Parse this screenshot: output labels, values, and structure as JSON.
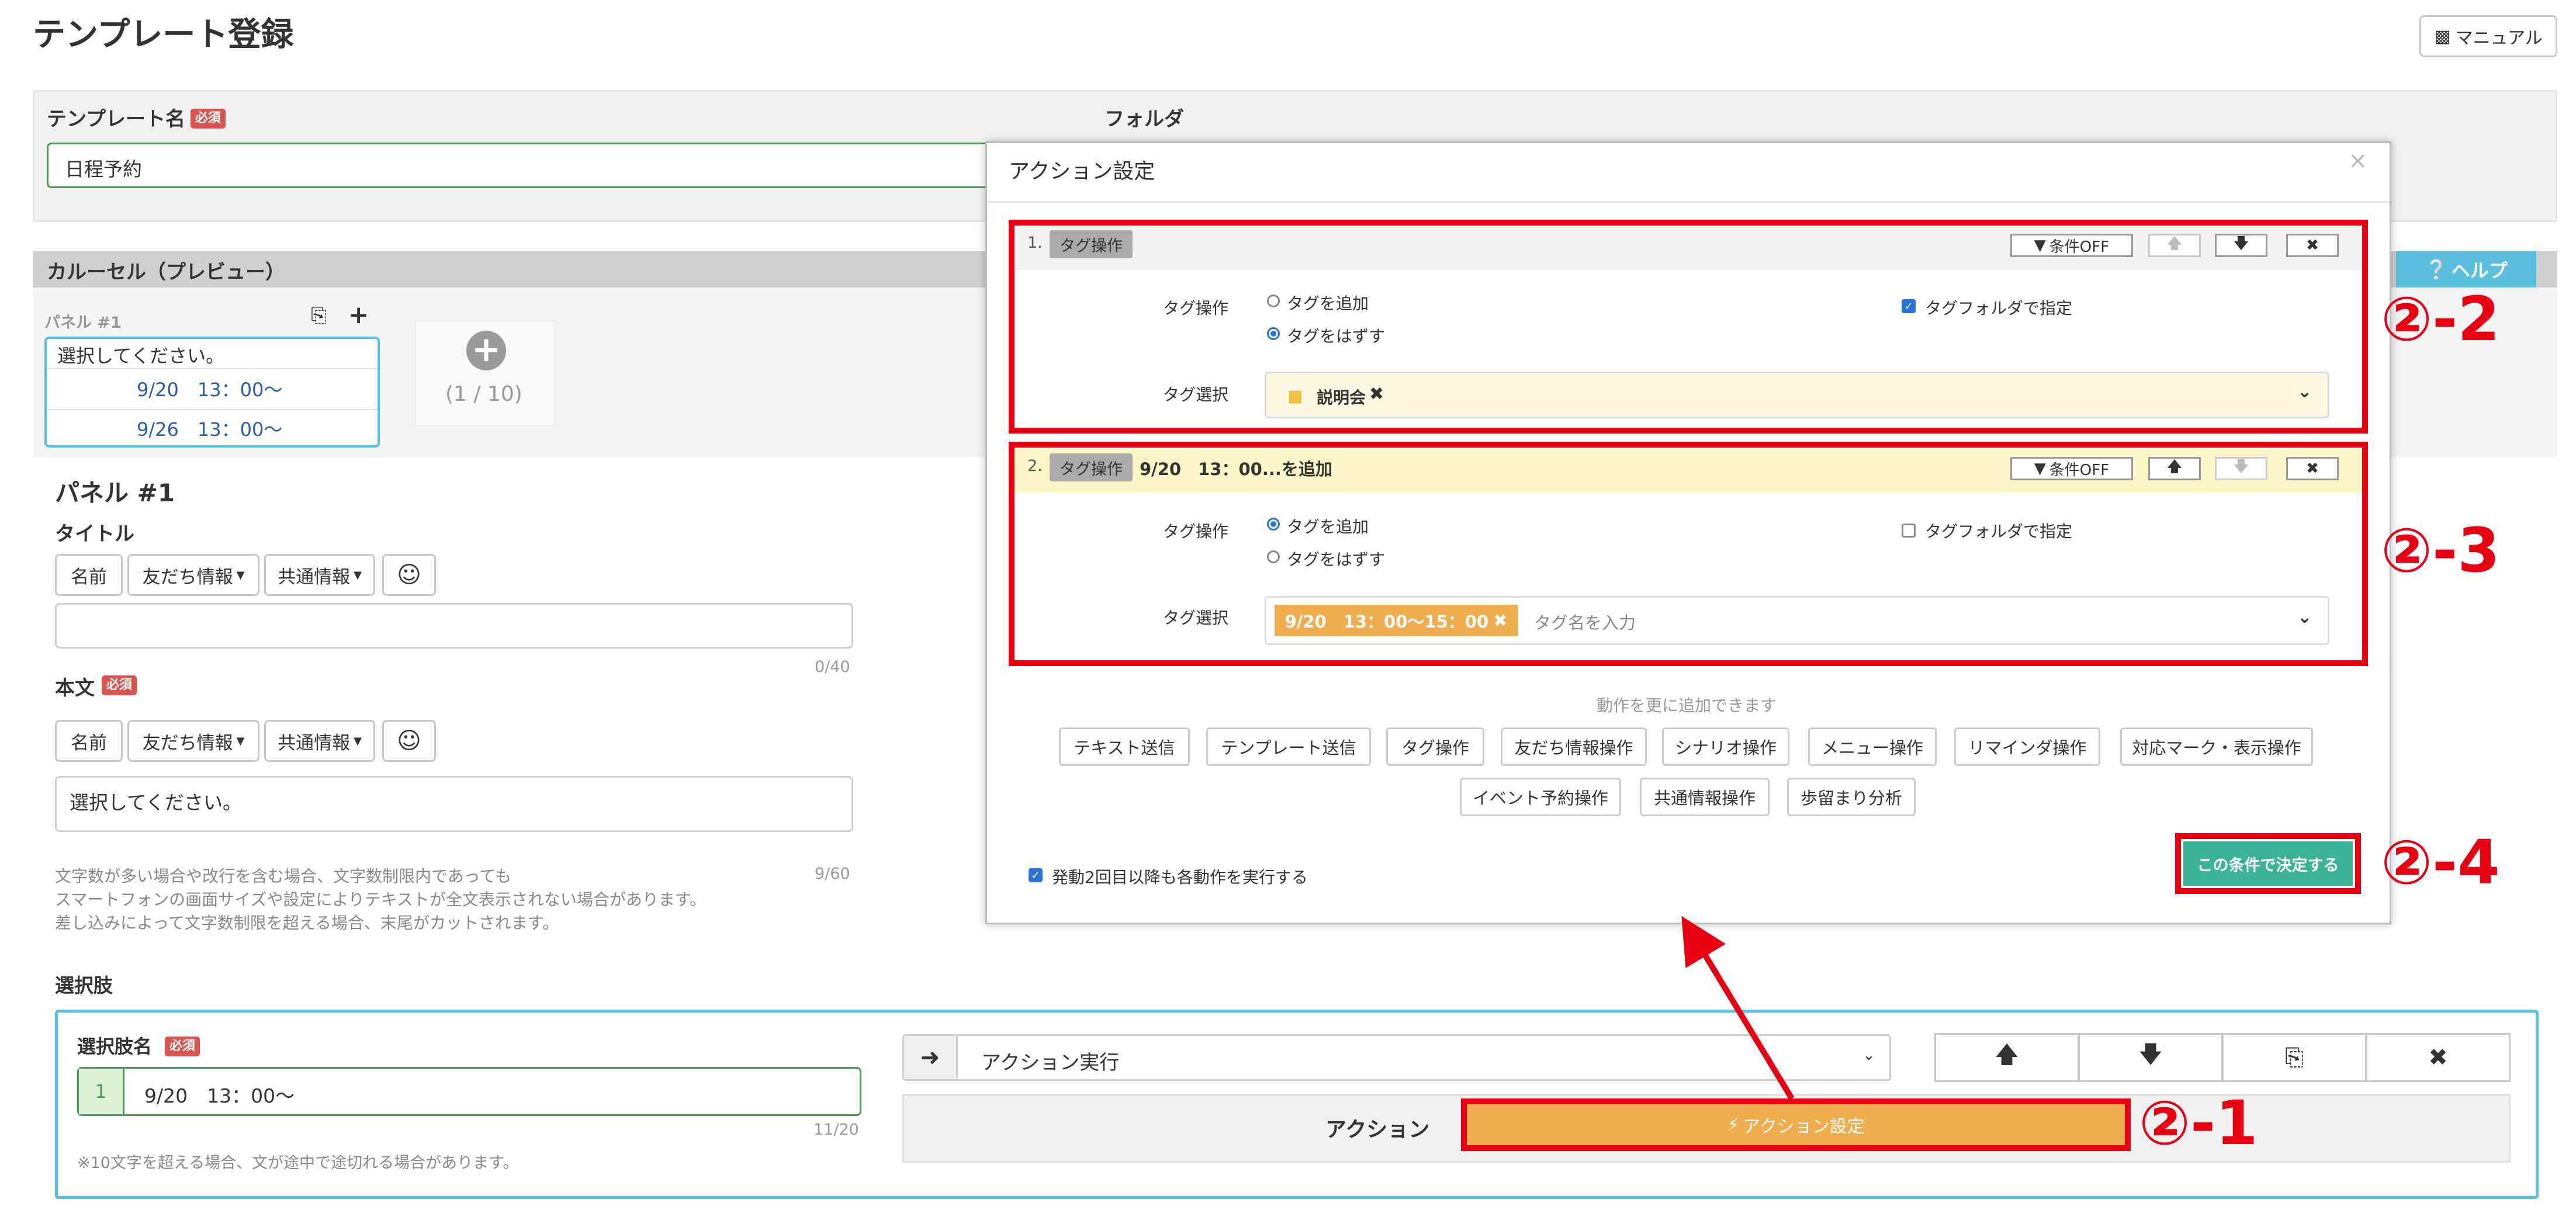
{
  "page": {
    "title": "テンプレート登録",
    "manual_button": "マニュアル"
  },
  "form": {
    "template_name_label": "テンプレート名",
    "required_badge": "必須",
    "template_name_value": "日程予約",
    "folder_label": "フォルダ"
  },
  "carousel": {
    "header": "カルーセル（プレビュー）",
    "help_label": "ヘルプ",
    "panel_tab_label": "パネル #1",
    "preview_text": "選択してください。",
    "preview_options": [
      "9/20　13：00〜",
      "9/26　13：00〜"
    ],
    "counter": "(1 / 10)"
  },
  "panel": {
    "heading": "パネル #1",
    "title_label": "タイトル",
    "insert_buttons": [
      "名前",
      "友だち情報",
      "共通情報"
    ],
    "title_count": "0/40",
    "body_label": "本文",
    "body_value": "選択してください。",
    "body_count": "9/60",
    "notes": [
      "文字数が多い場合や改行を含む場合、文字数制限内であっても",
      "スマートフォンの画面サイズや設定によりテキストが全文表示されない場合があります。",
      "差し込みによって文字数制限を超える場合、末尾がカットされます。"
    ]
  },
  "choices": {
    "section_label": "選択肢",
    "name_label": "選択肢名",
    "index": "1",
    "name_value": "9/20　13：00〜",
    "name_count": "11/20",
    "name_note": "※10文字を超える場合、文が途中で途切れる場合があります。",
    "action_select_value": "アクション実行",
    "action_label": "アクション",
    "action_button": "アクション設定"
  },
  "modal": {
    "title": "アクション設定",
    "condition_off": "条件OFF",
    "item1": {
      "number": "1.",
      "type_badge": "タグ操作",
      "summary": "",
      "op_label": "タグ操作",
      "option_add": "タグを追加",
      "option_remove": "タグをはずす",
      "folder_check": "タグフォルダで指定",
      "select_label": "タグ選択",
      "selected_tag": "説明会"
    },
    "item2": {
      "number": "2.",
      "type_badge": "タグ操作",
      "summary": "9/20　13：00...を追加",
      "op_label": "タグ操作",
      "option_add": "タグを追加",
      "option_remove": "タグをはずす",
      "folder_check": "タグフォルダで指定",
      "select_label": "タグ選択",
      "selected_tag": "9/20　13：00〜15：00",
      "tag_placeholder": "タグ名を入力"
    },
    "more_actions_hint": "動作を更に追加できます",
    "action_buttons_row1": [
      "テキスト送信",
      "テンプレート送信",
      "タグ操作",
      "友だち情報操作",
      "シナリオ操作",
      "メニュー操作",
      "リマインダ操作",
      "対応マーク・表示操作"
    ],
    "action_buttons_row2": [
      "イベント予約操作",
      "共通情報操作",
      "歩留まり分析"
    ],
    "repeat_check": "発動2回目以降も各動作を実行する",
    "confirm_button": "この条件で決定する"
  },
  "callouts": {
    "c1": "②-1",
    "c2": "②-2",
    "c3": "②-3",
    "c4": "②-4"
  },
  "colors": {
    "accent_red": "#e60012",
    "confirm_green": "#3bb397",
    "action_orange": "#f0ad4e",
    "help_blue": "#5bc0de"
  }
}
